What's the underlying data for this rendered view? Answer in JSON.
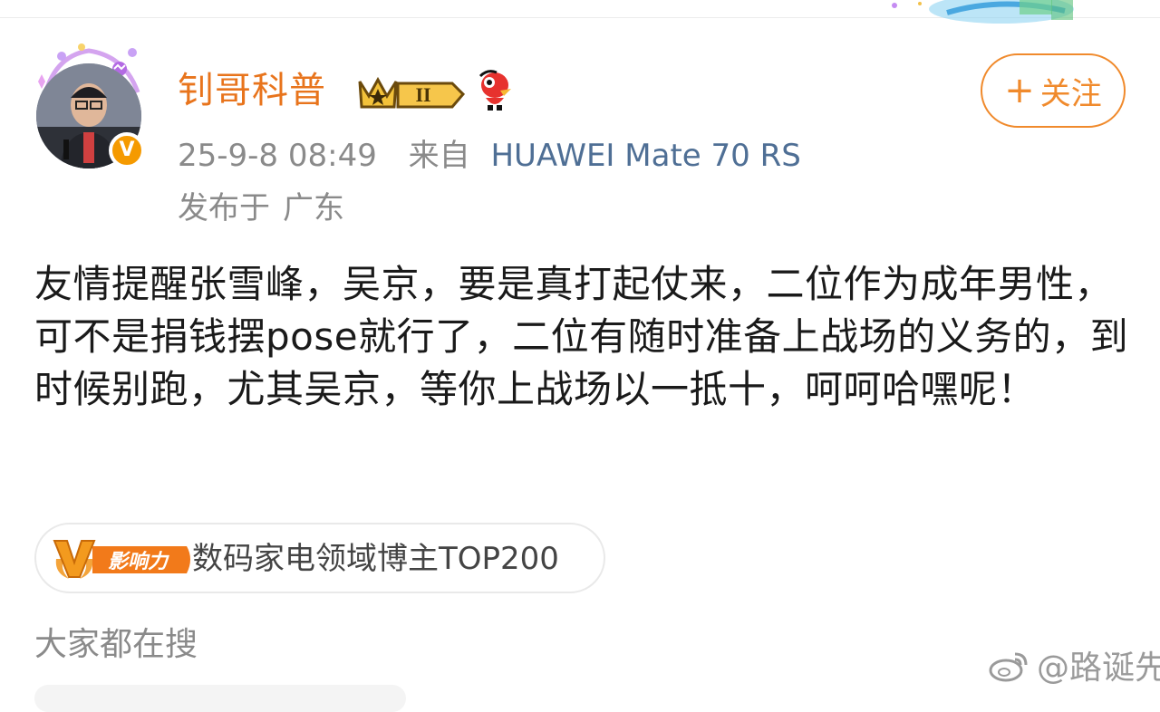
{
  "post": {
    "author": {
      "name": "钊哥科普",
      "level_badge": "II",
      "verified_mark": "V"
    },
    "follow_button": {
      "icon": "plus-icon",
      "label": "关注"
    },
    "meta": {
      "time": "25-9-8 08:49",
      "from_label": "来自",
      "device": "HUAWEI Mate 70 RS",
      "location_label": "发布于",
      "location": "广东"
    },
    "text": "友情提醒张雪峰，吴京，要是真打起仗来，二位作为成年男性，可不是捐钱摆pose就行了，二位有随时准备上战场的义务的，到时候别跑，尤其吴京，等你上战场以一抵十，呵呵哈嘿呢！",
    "influence": {
      "badge_label": "影响力",
      "badge_letter": "V",
      "text": "数码家电领域博主TOP200"
    }
  },
  "search_section": {
    "heading": "大家都在搜"
  },
  "watermark": {
    "text": "@路诞先生"
  },
  "colors": {
    "username": "#e8741c",
    "follow": "#f08a2c",
    "device_link": "#4f6f95",
    "meta": "#8a8a8a",
    "body_text": "#1a1a1a"
  }
}
